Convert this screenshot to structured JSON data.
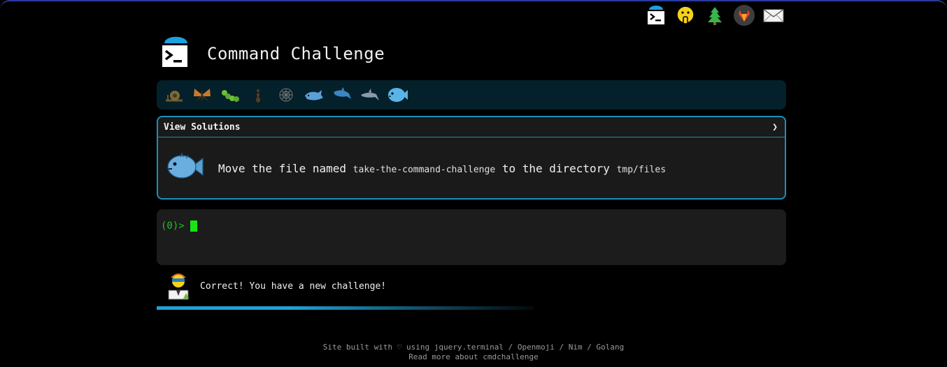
{
  "app": {
    "title": "Command Challenge"
  },
  "topbar": {
    "icons": [
      "terminal-logo-icon",
      "shushing-face-icon",
      "tree-icon",
      "gitlab-icon",
      "mail-icon"
    ]
  },
  "levels": [
    {
      "icon": "snail-icon"
    },
    {
      "icon": "butterfly-icon"
    },
    {
      "icon": "caterpillar-icon"
    },
    {
      "icon": "ant-icon"
    },
    {
      "icon": "web-icon"
    },
    {
      "icon": "whale-icon"
    },
    {
      "icon": "dolphin-blue-icon"
    },
    {
      "icon": "dolphin-grey-icon"
    },
    {
      "icon": "blowfish-icon"
    }
  ],
  "challenge": {
    "solutions_label": "View Solutions",
    "chevron": "❯",
    "text_before": "Move the file named",
    "filename": "take-the-command-challenge",
    "text_middle": "to the directory",
    "dirname": "tmp/files"
  },
  "terminal": {
    "prompt": "(0)>"
  },
  "feedback": {
    "message": "Correct! You have a new challenge!",
    "progress": 0.4
  },
  "footer": {
    "line1": "Site built with ♡ using jquery.terminal / Openmoji / Nim / Golang",
    "line2": "Read more about cmdchallenge"
  },
  "colors": {
    "accent": "#1b8fb8",
    "prompt_green": "#1fc31f",
    "level_bar_bg": "#04202a"
  }
}
